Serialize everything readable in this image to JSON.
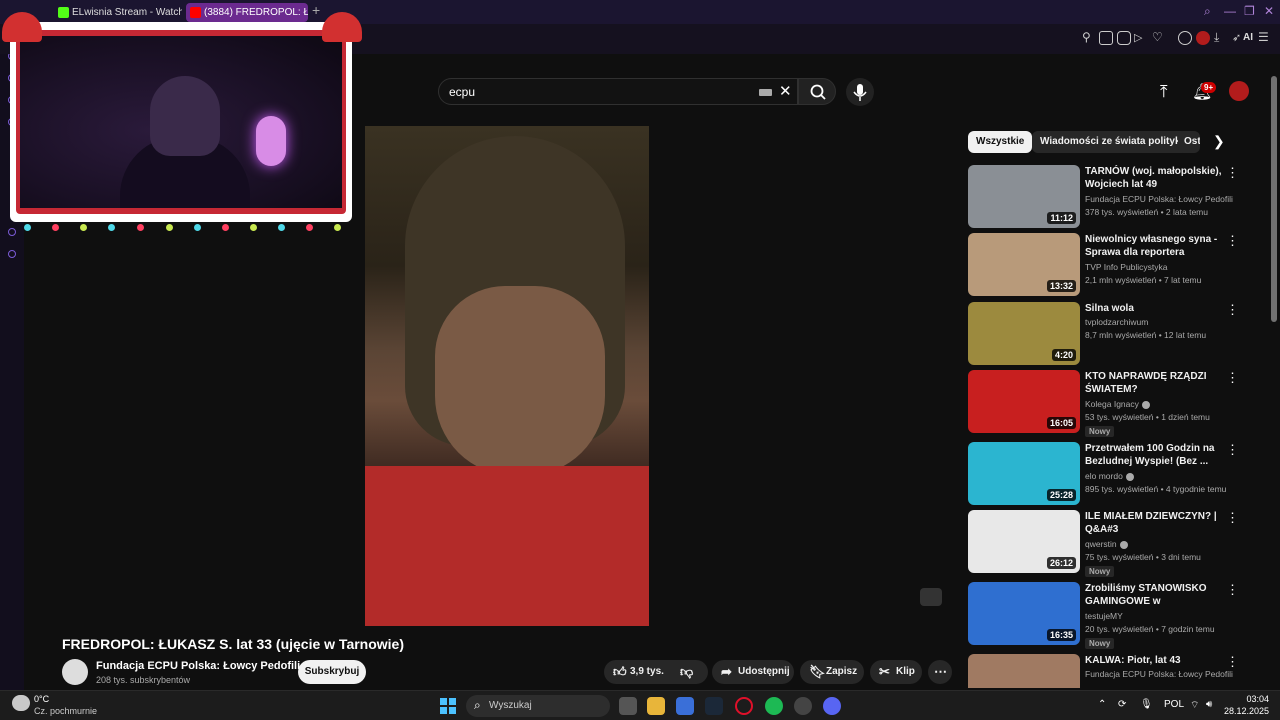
{
  "browser": {
    "tabs": [
      {
        "label": "ELwisnia Stream - Watch L",
        "icon_color": "#53fc18"
      },
      {
        "label": "(3884) FREDROPOL: Ł",
        "icon_color": "#ff0000"
      }
    ],
    "new_tab": "+",
    "toolbar_ai": "AI"
  },
  "youtube": {
    "search_value": "ecpu",
    "clear_glyph": "✕",
    "notifications_badge": "9+",
    "video_title": "FREDROPOL: ŁUKASZ S. lat 33 (ujęcie w Tarnowie)",
    "channel_name": "Fundacja ECPU Polska: Łowcy Pedofili",
    "channel_subs": "208 tys. subskrybentów",
    "subscribe_label": "Subskrybuj",
    "actions": {
      "like_count": "3,9 tys.",
      "share": "Udostępnij",
      "save": "Zapisz",
      "clip": "Klip"
    },
    "chips": [
      "Wszystkie",
      "Wiadomości ze świata polityki",
      "Ost"
    ],
    "recommendations": [
      {
        "title": "TARNÓW (woj. małopolskie), Wojciech lat 49",
        "channel": "Fundacja ECPU Polska: Łowcy Pedofili",
        "meta": "378 tys. wyświetleń • 2 lata temu",
        "duration": "11:12",
        "verified": false,
        "badge": "",
        "thumb_color": "#8a8f95"
      },
      {
        "title": "Niewolnicy własnego syna - Sprawa dla reportera",
        "channel": "TVP Info Publicystyka",
        "meta": "2,1 mln wyświetleń • 7 lat temu",
        "duration": "13:32",
        "verified": false,
        "badge": "",
        "thumb_color": "#b89a7a"
      },
      {
        "title": "Silna wola",
        "channel": "tvplodzarchiwum",
        "meta": "8,7 mln wyświetleń • 12 lat temu",
        "duration": "4:20",
        "verified": false,
        "badge": "",
        "thumb_color": "#9c8a3e"
      },
      {
        "title": "KTO NAPRAWDĘ RZĄDZI ŚWIATEM?",
        "channel": "Kolega Ignacy",
        "meta": "53 tys. wyświetleń • 1 dzień temu",
        "duration": "16:05",
        "verified": true,
        "badge": "Nowy",
        "thumb_color": "#c81f1f"
      },
      {
        "title": "Przetrwałem 100 Godzin na Bezludnej Wyspie! (Bez ...",
        "channel": "elo mordo",
        "meta": "895 tys. wyświetleń • 4 tygodnie temu",
        "duration": "25:28",
        "verified": true,
        "badge": "",
        "thumb_color": "#2bb5d0"
      },
      {
        "title": "ILE MIAŁEM DZIEWCZYN? | Q&A#3",
        "channel": "qwerstin",
        "meta": "75 tys. wyświetleń • 3 dni temu",
        "duration": "26:12",
        "verified": true,
        "badge": "Nowy",
        "thumb_color": "#e8e8e8"
      },
      {
        "title": "Zrobiliśmy STANOWISKO GAMINGOWE w SAMOCHODZIE",
        "channel": "testujeMY",
        "meta": "20 tys. wyświetleń • 7 godzin temu",
        "duration": "16:35",
        "verified": false,
        "badge": "Nowy",
        "thumb_color": "#2f6fd0"
      },
      {
        "title": "KALWA: Piotr, lat 43",
        "channel": "Fundacja ECPU Polska: Łowcy Pedofili",
        "meta": "",
        "duration": "",
        "verified": false,
        "badge": "",
        "thumb_color": "#a07a62"
      }
    ]
  },
  "taskbar": {
    "weather_temp": "0°C",
    "weather_desc": "Cz. pochmurnie",
    "search_placeholder": "Wyszukaj",
    "language": "POL",
    "time": "03:04",
    "date": "28.12.2025"
  },
  "colors": {
    "accent": "#6b2a8f",
    "youtube_red": "#cc0000",
    "overlay_red": "#c62834"
  }
}
